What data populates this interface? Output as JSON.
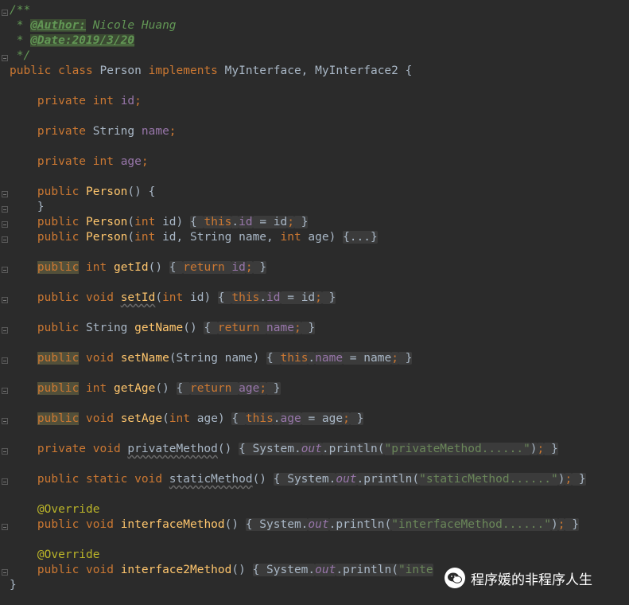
{
  "editor": {
    "lines": [
      {
        "segments": [
          {
            "t": "/**",
            "c": "cm"
          }
        ]
      },
      {
        "segments": [
          {
            "t": " * ",
            "c": "cm"
          },
          {
            "t": "@Author:",
            "c": "tag"
          },
          {
            "t": " Nicole Huang",
            "c": "cm"
          }
        ]
      },
      {
        "segments": [
          {
            "t": " * ",
            "c": "cm"
          },
          {
            "t": "@Date:2019/3/20",
            "c": "tag"
          }
        ]
      },
      {
        "segments": [
          {
            "t": " */",
            "c": "cm"
          }
        ]
      },
      {
        "segments": [
          {
            "t": "public class ",
            "c": "kw"
          },
          {
            "t": "Person ",
            "c": ""
          },
          {
            "t": "implements ",
            "c": "kw"
          },
          {
            "t": "MyInterface, MyInterface2 {",
            "c": ""
          }
        ]
      },
      {
        "segments": [
          {
            "t": "    private int ",
            "c": "kw"
          },
          {
            "t": "id",
            "c": "fld"
          },
          {
            "t": ";",
            "c": "kw"
          }
        ]
      },
      {
        "segments": [
          {
            "t": "    private ",
            "c": "kw"
          },
          {
            "t": "String ",
            "c": ""
          },
          {
            "t": "name",
            "c": "fld"
          },
          {
            "t": ";",
            "c": "kw"
          }
        ]
      },
      {
        "segments": [
          {
            "t": "    private int ",
            "c": "kw"
          },
          {
            "t": "age",
            "c": "fld"
          },
          {
            "t": ";",
            "c": "kw"
          }
        ]
      },
      {
        "segments": [
          {
            "t": "    public ",
            "c": "kw"
          },
          {
            "t": "Person",
            "c": "fn"
          },
          {
            "t": "() {",
            "c": ""
          }
        ]
      },
      {
        "segments": [
          {
            "t": "    }",
            "c": ""
          }
        ]
      },
      {
        "segments": [
          {
            "t": "    public ",
            "c": "kw"
          },
          {
            "t": "Person",
            "c": "fn"
          },
          {
            "t": "(",
            "c": ""
          },
          {
            "t": "int ",
            "c": "kw"
          },
          {
            "t": "id) ",
            "c": ""
          },
          {
            "t": "{ ",
            "c": "fbox"
          },
          {
            "t": "this",
            "c": "kw fbox"
          },
          {
            "t": ".",
            "c": "fbox"
          },
          {
            "t": "id",
            "c": "fld fbox"
          },
          {
            "t": " = id",
            "c": "fbox"
          },
          {
            "t": ";",
            "c": "kw fbox"
          },
          {
            "t": " }",
            "c": "fbox"
          }
        ]
      },
      {
        "segments": [
          {
            "t": "    public ",
            "c": "kw"
          },
          {
            "t": "Person",
            "c": "fn"
          },
          {
            "t": "(",
            "c": ""
          },
          {
            "t": "int ",
            "c": "kw"
          },
          {
            "t": "id, String name, ",
            "c": ""
          },
          {
            "t": "int ",
            "c": "kw"
          },
          {
            "t": "age) ",
            "c": ""
          },
          {
            "t": "{...}",
            "c": "fbox"
          }
        ]
      },
      {
        "segments": [
          {
            "t": "    ",
            "c": ""
          },
          {
            "t": "public",
            "c": "kw pbg"
          },
          {
            "t": " int ",
            "c": "kw"
          },
          {
            "t": "getId",
            "c": "fn"
          },
          {
            "t": "() ",
            "c": ""
          },
          {
            "t": "{ ",
            "c": "fbox"
          },
          {
            "t": "return ",
            "c": "kw fbox"
          },
          {
            "t": "id",
            "c": "fld fbox"
          },
          {
            "t": ";",
            "c": "kw fbox"
          },
          {
            "t": " }",
            "c": "fbox"
          }
        ]
      },
      {
        "segments": [
          {
            "t": "    public void ",
            "c": "kw"
          },
          {
            "t": "setId",
            "c": "fn wavy"
          },
          {
            "t": "(",
            "c": ""
          },
          {
            "t": "int ",
            "c": "kw"
          },
          {
            "t": "id) ",
            "c": ""
          },
          {
            "t": "{ ",
            "c": "fbox"
          },
          {
            "t": "this",
            "c": "kw fbox"
          },
          {
            "t": ".",
            "c": "fbox"
          },
          {
            "t": "id",
            "c": "fld fbox"
          },
          {
            "t": " = id",
            "c": "fbox"
          },
          {
            "t": ";",
            "c": "kw fbox"
          },
          {
            "t": " }",
            "c": "fbox"
          }
        ]
      },
      {
        "segments": [
          {
            "t": "    public ",
            "c": "kw"
          },
          {
            "t": "String ",
            "c": ""
          },
          {
            "t": "getName",
            "c": "fn"
          },
          {
            "t": "() ",
            "c": ""
          },
          {
            "t": "{ ",
            "c": "fbox"
          },
          {
            "t": "return ",
            "c": "kw fbox"
          },
          {
            "t": "name",
            "c": "fld fbox"
          },
          {
            "t": ";",
            "c": "kw fbox"
          },
          {
            "t": " }",
            "c": "fbox"
          }
        ]
      },
      {
        "segments": [
          {
            "t": "    ",
            "c": ""
          },
          {
            "t": "public",
            "c": "kw pbg"
          },
          {
            "t": " void ",
            "c": "kw"
          },
          {
            "t": "setName",
            "c": "fn"
          },
          {
            "t": "(String name) ",
            "c": ""
          },
          {
            "t": "{ ",
            "c": "fbox"
          },
          {
            "t": "this",
            "c": "kw fbox"
          },
          {
            "t": ".",
            "c": "fbox"
          },
          {
            "t": "name",
            "c": "fld fbox"
          },
          {
            "t": " = name",
            "c": "fbox"
          },
          {
            "t": ";",
            "c": "kw fbox"
          },
          {
            "t": " }",
            "c": "fbox"
          }
        ]
      },
      {
        "segments": [
          {
            "t": "    ",
            "c": ""
          },
          {
            "t": "public",
            "c": "kw pbg"
          },
          {
            "t": " int ",
            "c": "kw"
          },
          {
            "t": "getAge",
            "c": "fn"
          },
          {
            "t": "() ",
            "c": ""
          },
          {
            "t": "{ ",
            "c": "fbox"
          },
          {
            "t": "return ",
            "c": "kw fbox"
          },
          {
            "t": "age",
            "c": "fld fbox"
          },
          {
            "t": ";",
            "c": "kw fbox"
          },
          {
            "t": " }",
            "c": "fbox"
          }
        ]
      },
      {
        "segments": [
          {
            "t": "    ",
            "c": ""
          },
          {
            "t": "public",
            "c": "kw pbg"
          },
          {
            "t": " void ",
            "c": "kw"
          },
          {
            "t": "setAge",
            "c": "fn"
          },
          {
            "t": "(",
            "c": ""
          },
          {
            "t": "int ",
            "c": "kw"
          },
          {
            "t": "age) ",
            "c": ""
          },
          {
            "t": "{ ",
            "c": "fbox"
          },
          {
            "t": "this",
            "c": "kw fbox"
          },
          {
            "t": ".",
            "c": "fbox"
          },
          {
            "t": "age",
            "c": "fld fbox"
          },
          {
            "t": " = age",
            "c": "fbox"
          },
          {
            "t": ";",
            "c": "kw fbox"
          },
          {
            "t": " }",
            "c": "fbox"
          }
        ]
      },
      {
        "segments": [
          {
            "t": "    private void ",
            "c": "kw"
          },
          {
            "t": "privateMethod",
            "c": "wavy"
          },
          {
            "t": "() ",
            "c": ""
          },
          {
            "t": "{ System.",
            "c": "fbox"
          },
          {
            "t": "out",
            "c": "ital fbox"
          },
          {
            "t": ".println(",
            "c": "fbox"
          },
          {
            "t": "\"privateMethod......\"",
            "c": "str fbox"
          },
          {
            "t": ")",
            "c": "fbox"
          },
          {
            "t": ";",
            "c": "kw fbox"
          },
          {
            "t": " }",
            "c": "fbox"
          }
        ]
      },
      {
        "segments": [
          {
            "t": "    public static void ",
            "c": "kw"
          },
          {
            "t": "staticMethod",
            "c": "wavy"
          },
          {
            "t": "() ",
            "c": ""
          },
          {
            "t": "{ System.",
            "c": "fbox"
          },
          {
            "t": "out",
            "c": "ital fbox"
          },
          {
            "t": ".println(",
            "c": "fbox"
          },
          {
            "t": "\"staticMethod......\"",
            "c": "str fbox"
          },
          {
            "t": ")",
            "c": "fbox"
          },
          {
            "t": ";",
            "c": "kw fbox"
          },
          {
            "t": " }",
            "c": "fbox"
          }
        ]
      },
      {
        "segments": [
          {
            "t": "    @Override",
            "c": "ann"
          }
        ]
      },
      {
        "segments": [
          {
            "t": "    public void ",
            "c": "kw"
          },
          {
            "t": "interfaceMethod",
            "c": "fn"
          },
          {
            "t": "() ",
            "c": ""
          },
          {
            "t": "{ System.",
            "c": "fbox"
          },
          {
            "t": "out",
            "c": "ital fbox"
          },
          {
            "t": ".println(",
            "c": "fbox"
          },
          {
            "t": "\"interfaceMethod......\"",
            "c": "str fbox"
          },
          {
            "t": ")",
            "c": "fbox"
          },
          {
            "t": ";",
            "c": "kw fbox"
          },
          {
            "t": " }",
            "c": "fbox"
          }
        ]
      },
      {
        "segments": [
          {
            "t": "    @Override",
            "c": "ann"
          }
        ]
      },
      {
        "segments": [
          {
            "t": "    public void ",
            "c": "kw"
          },
          {
            "t": "interface2Method",
            "c": "fn"
          },
          {
            "t": "() ",
            "c": ""
          },
          {
            "t": "{ System.",
            "c": "fbox"
          },
          {
            "t": "out",
            "c": "ital fbox"
          },
          {
            "t": ".println(",
            "c": "fbox"
          },
          {
            "t": "\"inte",
            "c": "str fbox"
          }
        ]
      },
      {
        "segments": [
          {
            "t": "}",
            "c": ""
          }
        ]
      }
    ]
  },
  "watermark": {
    "text": "程序媛的非程序人生",
    "icon": "wechat-icon"
  }
}
